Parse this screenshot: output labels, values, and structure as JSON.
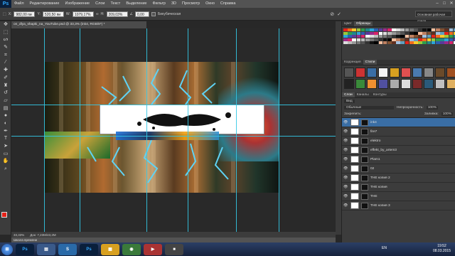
{
  "menubar": {
    "logo": "Ps",
    "items": [
      "Файл",
      "Редактирование",
      "Изображение",
      "Слои",
      "Текст",
      "Выделение",
      "Фильтр",
      "3D",
      "Просмотр",
      "Окно",
      "Справка"
    ]
  },
  "options": {
    "x_label": "X:",
    "x_value": "982,00 пи",
    "y_label": "Y:",
    "y_value": "520,50 пи",
    "w_label": "W:",
    "w_value": "1079,17%",
    "h_label": "H:",
    "h_value": "209,03%",
    "angle_value": "0,00",
    "interp": "Бикубическая",
    "cancel_icon": "cancel-icon",
    "confirm_icon": "check-icon",
    "workspace": "Основная рабочая среда"
  },
  "document": {
    "tab_title": "on_dlya_shapki_na_YouTube.psd @ 33,3% (ink4, RGB/8*) *",
    "zoom": "33,33%",
    "doc_size": "Док: 7,23M/43,2M",
    "timeline": "Шкала времени",
    "status_left": "Шкала времени"
  },
  "panels": {
    "top_tabs": [
      "Цвет",
      "Образцы"
    ],
    "mid_tabs": [
      "Коррекция",
      "Стили"
    ],
    "layer_tabs": [
      "Слои",
      "Каналы",
      "Контуры"
    ],
    "filter_label": "Вид",
    "blend_mode": "Обычные",
    "opacity_label": "Непрозрачность:",
    "opacity_value": "100%",
    "lock_label": "Закрепить:",
    "fill_label": "Заливка:",
    "fill_value": "100%"
  },
  "layers": [
    {
      "name": "ink4",
      "selected": true
    },
    {
      "name": "fire7",
      "selected": false
    },
    {
      "name": "elektro",
      "selected": false
    },
    {
      "name": "effekt_by_artem3",
      "selected": false
    },
    {
      "name": "Plam1",
      "selected": false
    },
    {
      "name": "02",
      "selected": false
    },
    {
      "name": "THE копия 2",
      "selected": false
    },
    {
      "name": "THE копия",
      "selected": false
    },
    {
      "name": "THE",
      "selected": false
    },
    {
      "name": "THE копия 3",
      "selected": false
    }
  ],
  "taskbar": {
    "lang": "EN",
    "time": "19:52",
    "date": "08.03.2015",
    "apps": [
      "Ps",
      "Ps"
    ]
  },
  "colors": {
    "accent": "#3a6ea5",
    "guide": "#33c8e6",
    "foreground": "#e52218"
  },
  "tools": [
    "move-tool",
    "marquee-tool",
    "lasso-tool",
    "quick-select-tool",
    "crop-tool",
    "eyedropper-tool",
    "healing-tool",
    "brush-tool",
    "stamp-tool",
    "history-brush-tool",
    "eraser-tool",
    "gradient-tool",
    "blur-tool",
    "dodge-tool",
    "pen-tool",
    "type-tool",
    "path-select-tool",
    "shape-tool",
    "hand-tool",
    "zoom-tool"
  ]
}
